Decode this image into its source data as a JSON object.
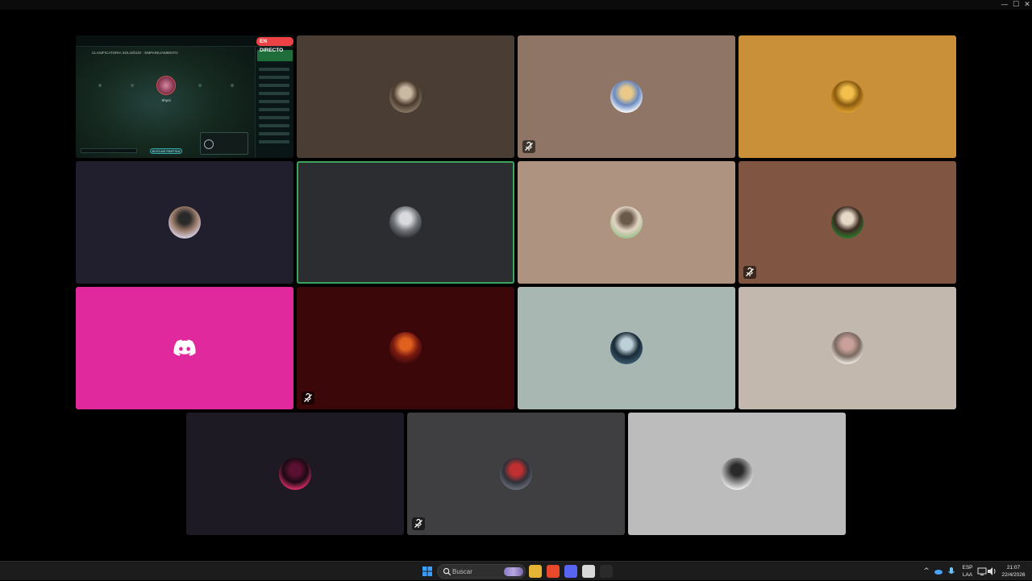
{
  "window": {
    "controls": {
      "minimize": "—",
      "maximize": "☐",
      "close": "✕"
    }
  },
  "stream": {
    "live_badge": "EN DIRECTO",
    "game_title": "CLASIFICATORIA SOLO/DÚO · EMPAREJAMIENTO",
    "game_player_name": "Shyni",
    "game_button": "BUSCAR PARTIDA"
  },
  "participants": [
    {
      "id": "p2",
      "bg": "#4a3e34",
      "avatar": [
        "#8a7a68",
        "#c9b9a3",
        "#4a3a2c"
      ],
      "muted": false,
      "speaking": false
    },
    {
      "id": "p3",
      "bg": "#8f7565",
      "avatar": [
        "#ffffff",
        "#e8c98a",
        "#6a8ac0"
      ],
      "muted": true,
      "speaking": false
    },
    {
      "id": "p4",
      "bg": "#c99039",
      "avatar": [
        "#e0a22c",
        "#f3c04b",
        "#8a5a10"
      ],
      "muted": false,
      "speaking": false
    },
    {
      "id": "p5",
      "bg": "#211f2d",
      "avatar": [
        "#d6d0e8",
        "#2a2a2a",
        "#9a7a68"
      ],
      "muted": false,
      "speaking": false
    },
    {
      "id": "p6",
      "bg": "#2b2d31",
      "avatar": [
        "#2b2d31",
        "#d8dadd",
        "#6f7378"
      ],
      "muted": false,
      "speaking": true
    },
    {
      "id": "p7",
      "bg": "#ae9480",
      "avatar": [
        "#9bbf8a",
        "#6a5a4a",
        "#e2d4c4"
      ],
      "muted": false,
      "speaking": false
    },
    {
      "id": "p8",
      "bg": "#805541",
      "avatar": [
        "#2e7a2e",
        "#e6d9c6",
        "#3a2a20"
      ],
      "muted": true,
      "speaking": false
    },
    {
      "id": "p9",
      "bg": "#e0299d",
      "avatar": [],
      "muted": false,
      "speaking": false,
      "discord_default": true
    },
    {
      "id": "p10",
      "bg": "#3b0709",
      "avatar": [
        "#3b0709",
        "#e0601e",
        "#7a1a10"
      ],
      "muted": true,
      "speaking": false
    },
    {
      "id": "p11",
      "bg": "#a8b7b2",
      "avatar": [
        "#3a5a70",
        "#bcd0d8",
        "#1a2a36"
      ],
      "muted": false,
      "speaking": false
    },
    {
      "id": "p12",
      "bg": "#c2b8ad",
      "avatar": [
        "#f2efe9",
        "#c9a09a",
        "#7a6a60"
      ],
      "muted": false,
      "speaking": false
    },
    {
      "id": "p13",
      "bg": "#1d1a23",
      "avatar": [
        "#e0306a",
        "#5a1030",
        "#1a0a14"
      ],
      "muted": false,
      "speaking": false
    },
    {
      "id": "p14",
      "bg": "#3f3f42",
      "avatar": [
        "#6a6f7a",
        "#c03030",
        "#2e3038"
      ],
      "muted": true,
      "speaking": false
    },
    {
      "id": "p15",
      "bg": "#bcbcbc",
      "avatar": [
        "#f4f4f4",
        "#2a2a2a",
        "#8a8a8a"
      ],
      "muted": false,
      "speaking": false
    }
  ],
  "taskbar": {
    "search_placeholder": "Buscar",
    "apps": [
      {
        "icon": "file-explorer-icon",
        "color": "#e6b435"
      },
      {
        "icon": "brave-browser-icon",
        "color": "#e8492c"
      },
      {
        "icon": "discord-icon",
        "color": "#5865f2"
      },
      {
        "icon": "app-icon",
        "color": "#d8d8d8"
      },
      {
        "icon": "terminal-icon",
        "color": "#2a2a2a"
      }
    ],
    "tray": {
      "language_line1": "ESP",
      "language_line2": "LAA",
      "time": "21:07",
      "date": "22/4/2026"
    }
  }
}
